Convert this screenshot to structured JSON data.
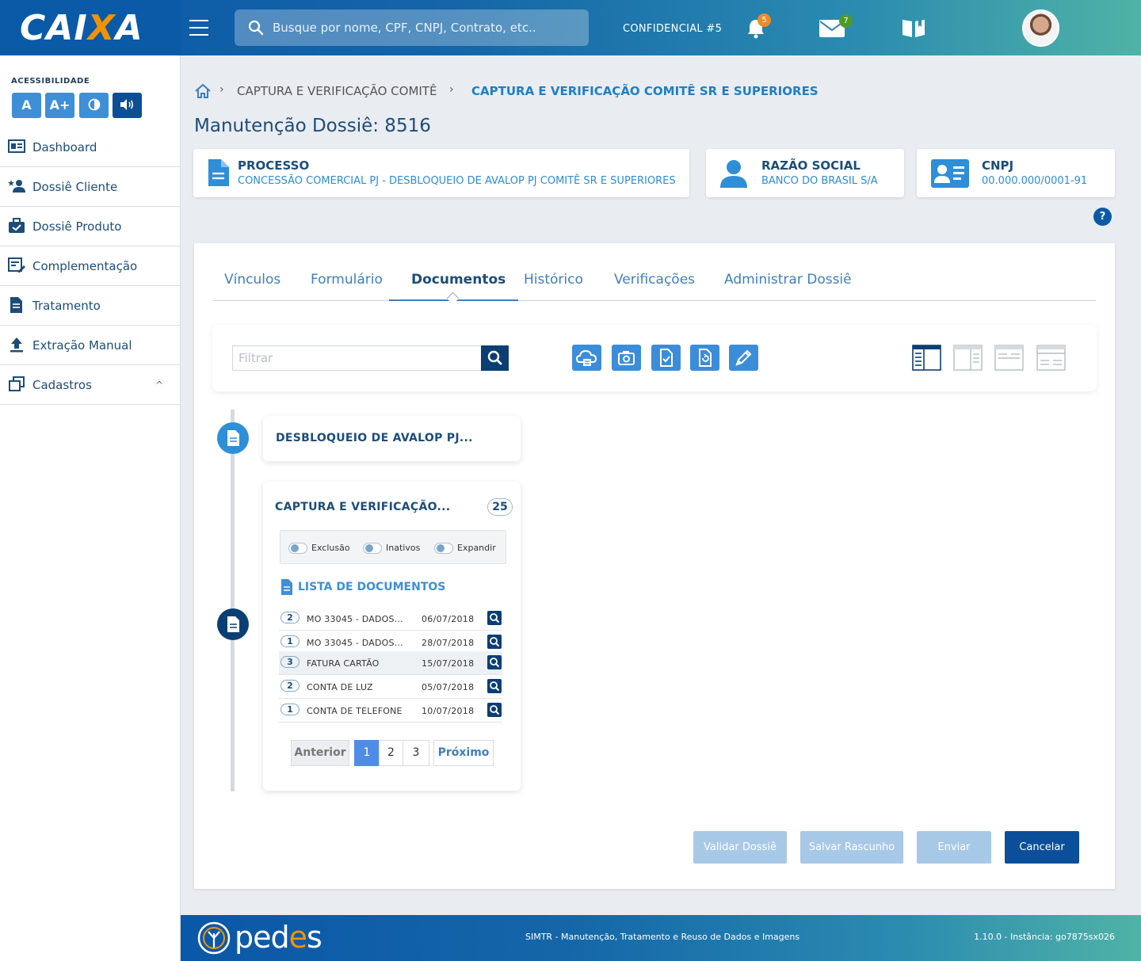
{
  "header": {
    "logo_prefix": "CAI",
    "logo_x": "X",
    "logo_suffix": "A",
    "search_placeholder": "Busque por nome, CPF, CNPJ, Contrato, etc..",
    "confidential_label": "CONFIDENCIAL #5",
    "notifications_count": "5",
    "messages_count": "7",
    "notifications_badge_color": "#f08a24",
    "messages_badge_color": "#4d9a2a"
  },
  "sidebar": {
    "accessibility_label": "ACESSIBILIDADE",
    "acc_buttons": [
      "A",
      "A+"
    ],
    "items": [
      {
        "label": "Dashboard",
        "icon": "dashboard-icon"
      },
      {
        "label": "Dossiê Cliente",
        "icon": "user-star-icon"
      },
      {
        "label": "Dossiê Produto",
        "icon": "briefcase-check-icon"
      },
      {
        "label": "Complementação",
        "icon": "form-edit-icon"
      },
      {
        "label": "Tratamento",
        "icon": "document-icon"
      },
      {
        "label": "Extração Manual",
        "icon": "upload-icon"
      },
      {
        "label": "Cadastros",
        "icon": "copy-icon",
        "chevron": "^"
      }
    ]
  },
  "breadcrumb": {
    "items": [
      "CAPTURA E VERIFICAÇÃO COMITÊ",
      "CAPTURA E VERIFICAÇÃO COMITÊ SR E SUPERIORES"
    ],
    "separator": "›"
  },
  "page_title": "Manutenção Dossiê: 8516",
  "info_cards": {
    "processo": {
      "title": "PROCESSO",
      "value": "CONCESSÃO COMERCIAL PJ - DESBLOQUEIO DE AVALOP PJ COMITÊ SR E SUPERIORES"
    },
    "razao": {
      "title": "RAZÃO SOCIAL",
      "value": "BANCO DO BRASIL S/A"
    },
    "cnpj": {
      "title": "CNPJ",
      "value": "00.000.000/0001-91"
    }
  },
  "help_label": "?",
  "tabs": [
    {
      "label": "Vínculos",
      "active": false
    },
    {
      "label": "Formulário",
      "active": false
    },
    {
      "label": "Documentos",
      "active": true
    },
    {
      "label": "Histórico",
      "active": false
    },
    {
      "label": "Verificações",
      "active": false
    },
    {
      "label": "Administrar Dossiê",
      "active": false
    }
  ],
  "toolbar": {
    "filter_placeholder": "Filtrar",
    "tools": [
      "cloud-upload-icon",
      "camera-icon",
      "document-check-icon",
      "refresh-document-icon",
      "pen-icon"
    ],
    "views": [
      "view-sidebar-left-icon",
      "view-sidebar-right-icon",
      "view-rows-icon",
      "view-header-icon"
    ]
  },
  "timeline": {
    "card1": {
      "title": "DESBLOQUEIO DE AVALOP PJ..."
    },
    "card2": {
      "title": "CAPTURA E VERIFICAÇÃO...",
      "count": "25",
      "toggles": [
        "Exclusão",
        "Inativos",
        "Expandir"
      ],
      "list_title": "LISTA DE DOCUMENTOS",
      "documents": [
        {
          "num": "2",
          "name": "MO 33045 - DADOS...",
          "date": "06/07/2018",
          "highlight": false
        },
        {
          "num": "1",
          "name": "MO 33045 - DADOS...",
          "date": "28/07/2018",
          "highlight": false
        },
        {
          "num": "3",
          "name": "FATURA CARTÃO",
          "date": "15/07/2018",
          "highlight": true
        },
        {
          "num": "2",
          "name": "CONTA DE LUZ",
          "date": "05/07/2018",
          "highlight": false
        },
        {
          "num": "1",
          "name": "CONTA DE TELEFONE",
          "date": "10/07/2018",
          "highlight": false
        }
      ],
      "pagination": {
        "prev": "Anterior",
        "pages": [
          "1",
          "2",
          "3"
        ],
        "current": "1",
        "next": "Próximo"
      }
    }
  },
  "actions": {
    "validate": "Validar Dossiê",
    "save_draft": "Salvar Rascunho",
    "send": "Enviar",
    "cancel": "Cancelar"
  },
  "footer": {
    "brand_prefix": "ped",
    "brand_o": "e",
    "brand_suffix": "s",
    "center_text": "SIMTR - Manutenção, Tratamento e Reuso de Dados e Imagens",
    "version_text": "1.10.0 - Instância: go7875sx026"
  }
}
